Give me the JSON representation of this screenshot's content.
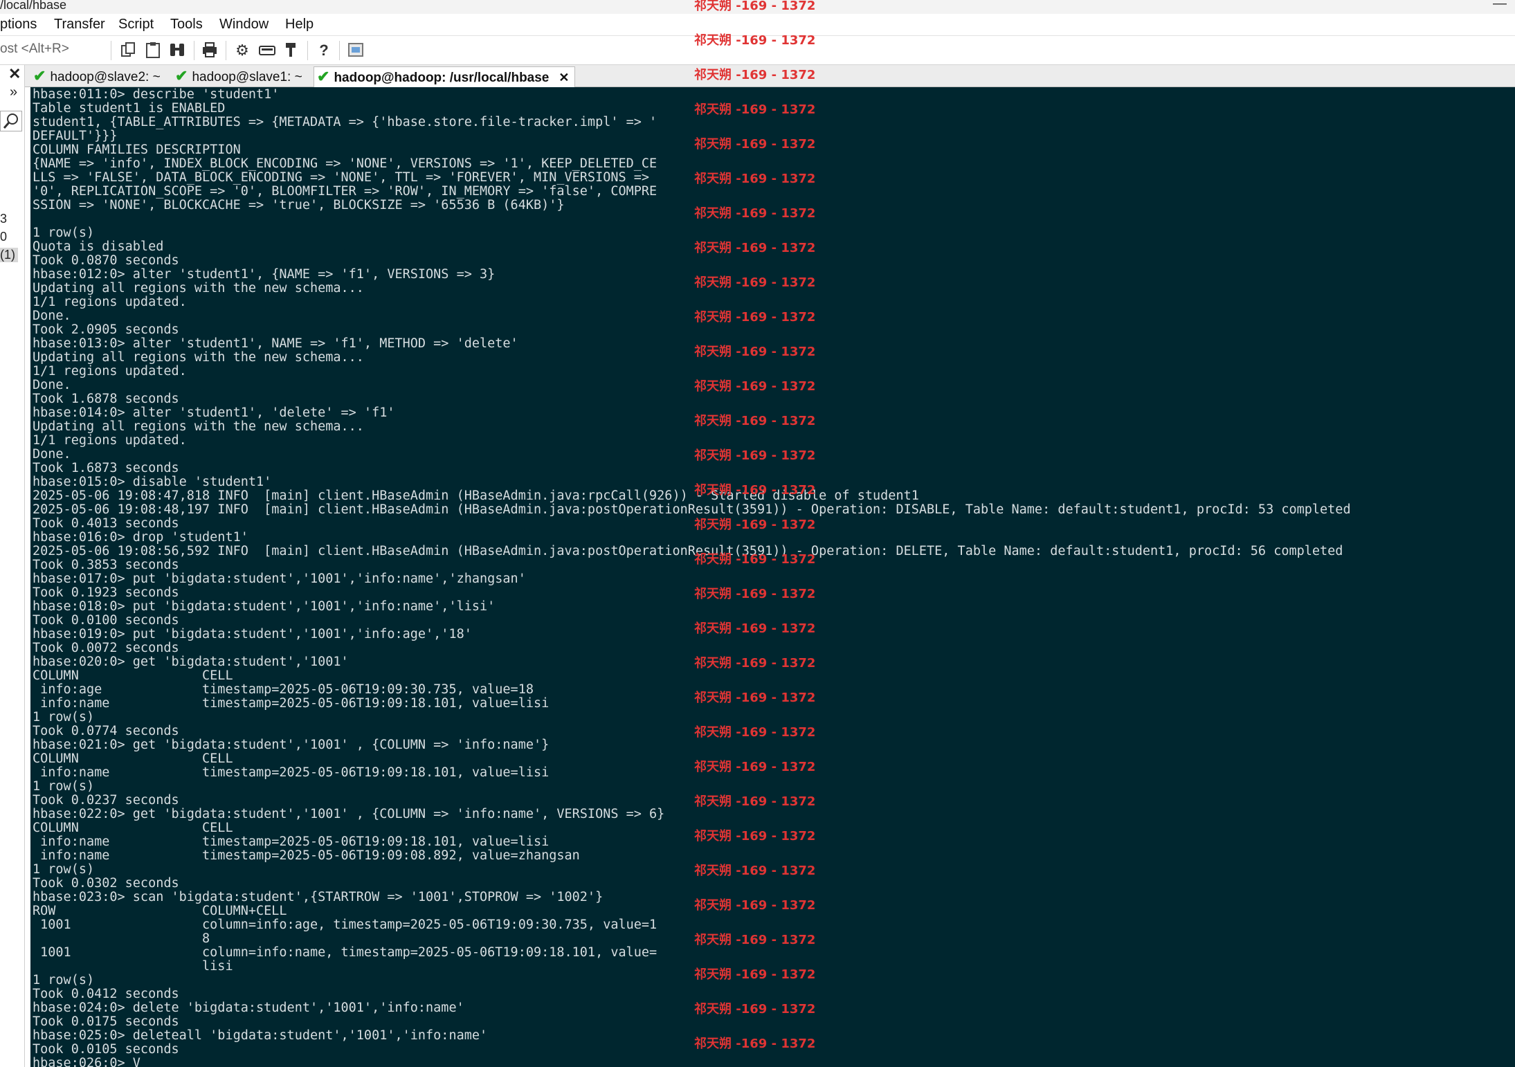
{
  "window": {
    "title": "/local/hbase"
  },
  "menu": [
    "ptions",
    "Transfer",
    "Script",
    "Tools",
    "Window",
    "Help"
  ],
  "toolbar": {
    "host_placeholder": "ost <Alt+R>"
  },
  "left_panel": {
    "items": [
      "3",
      "0",
      "(1)"
    ]
  },
  "tabs": [
    {
      "label": "hadoop@slave2: ~",
      "connected": true,
      "active": false
    },
    {
      "label": "hadoop@slave1: ~",
      "connected": true,
      "active": false
    },
    {
      "label": "hadoop@hadoop: /usr/local/hbase",
      "connected": true,
      "active": true
    }
  ],
  "colors": {
    "terminal_bg": "#00262f",
    "terminal_fg": "#d6dde0",
    "watermark": "#e03434",
    "connected_check": "#23a423"
  },
  "watermark_text": "祁天朔 -169 - 1372",
  "terminal_lines": [
    "hbase:011:0> describe 'student1'",
    "Table student1 is ENABLED",
    "student1, {TABLE_ATTRIBUTES => {METADATA => {'hbase.store.file-tracker.impl' => '",
    "DEFAULT'}}}",
    "COLUMN FAMILIES DESCRIPTION",
    "{NAME => 'info', INDEX_BLOCK_ENCODING => 'NONE', VERSIONS => '1', KEEP_DELETED_CE",
    "LLS => 'FALSE', DATA_BLOCK_ENCODING => 'NONE', TTL => 'FOREVER', MIN_VERSIONS =>",
    "'0', REPLICATION_SCOPE => '0', BLOOMFILTER => 'ROW', IN_MEMORY => 'false', COMPRE",
    "SSION => 'NONE', BLOCKCACHE => 'true', BLOCKSIZE => '65536 B (64KB)'}",
    "",
    "1 row(s)",
    "Quota is disabled",
    "Took 0.0870 seconds",
    "hbase:012:0> alter 'student1', {NAME => 'f1', VERSIONS => 3}",
    "Updating all regions with the new schema...",
    "1/1 regions updated.",
    "Done.",
    "Took 2.0905 seconds",
    "hbase:013:0> alter 'student1', NAME => 'f1', METHOD => 'delete'",
    "Updating all regions with the new schema...",
    "1/1 regions updated.",
    "Done.",
    "Took 1.6878 seconds",
    "hbase:014:0> alter 'student1', 'delete' => 'f1'",
    "Updating all regions with the new schema...",
    "1/1 regions updated.",
    "Done.",
    "Took 1.6873 seconds",
    "hbase:015:0> disable 'student1'",
    "2025-05-06 19:08:47,818 INFO  [main] client.HBaseAdmin (HBaseAdmin.java:rpcCall(926)) - Started disable of student1",
    "2025-05-06 19:08:48,197 INFO  [main] client.HBaseAdmin (HBaseAdmin.java:postOperationResult(3591)) - Operation: DISABLE, Table Name: default:student1, procId: 53 completed",
    "Took 0.4013 seconds",
    "hbase:016:0> drop 'student1'",
    "2025-05-06 19:08:56,592 INFO  [main] client.HBaseAdmin (HBaseAdmin.java:postOperationResult(3591)) - Operation: DELETE, Table Name: default:student1, procId: 56 completed",
    "Took 0.3853 seconds",
    "hbase:017:0> put 'bigdata:student','1001','info:name','zhangsan'",
    "Took 0.1923 seconds",
    "hbase:018:0> put 'bigdata:student','1001','info:name','lisi'",
    "Took 0.0100 seconds",
    "hbase:019:0> put 'bigdata:student','1001','info:age','18'",
    "Took 0.0072 seconds",
    "hbase:020:0> get 'bigdata:student','1001'",
    "COLUMN                CELL",
    " info:age             timestamp=2025-05-06T19:09:30.735, value=18",
    " info:name            timestamp=2025-05-06T19:09:18.101, value=lisi",
    "1 row(s)",
    "Took 0.0774 seconds",
    "hbase:021:0> get 'bigdata:student','1001' , {COLUMN => 'info:name'}",
    "COLUMN                CELL",
    " info:name            timestamp=2025-05-06T19:09:18.101, value=lisi",
    "1 row(s)",
    "Took 0.0237 seconds",
    "hbase:022:0> get 'bigdata:student','1001' , {COLUMN => 'info:name', VERSIONS => 6}",
    "COLUMN                CELL",
    " info:name            timestamp=2025-05-06T19:09:18.101, value=lisi",
    " info:name            timestamp=2025-05-06T19:09:08.892, value=zhangsan",
    "1 row(s)",
    "Took 0.0302 seconds",
    "hbase:023:0> scan 'bigdata:student',{STARTROW => '1001',STOPROW => '1002'}",
    "ROW                   COLUMN+CELL",
    " 1001                 column=info:age, timestamp=2025-05-06T19:09:30.735, value=1",
    "                      8",
    " 1001                 column=info:name, timestamp=2025-05-06T19:09:18.101, value=",
    "                      lisi",
    "1 row(s)",
    "Took 0.0412 seconds",
    "hbase:024:0> delete 'bigdata:student','1001','info:name'",
    "Took 0.0175 seconds",
    "hbase:025:0> deleteall 'bigdata:student','1001','info:name'",
    "Took 0.0105 seconds",
    "hbase:026:0> V"
  ]
}
